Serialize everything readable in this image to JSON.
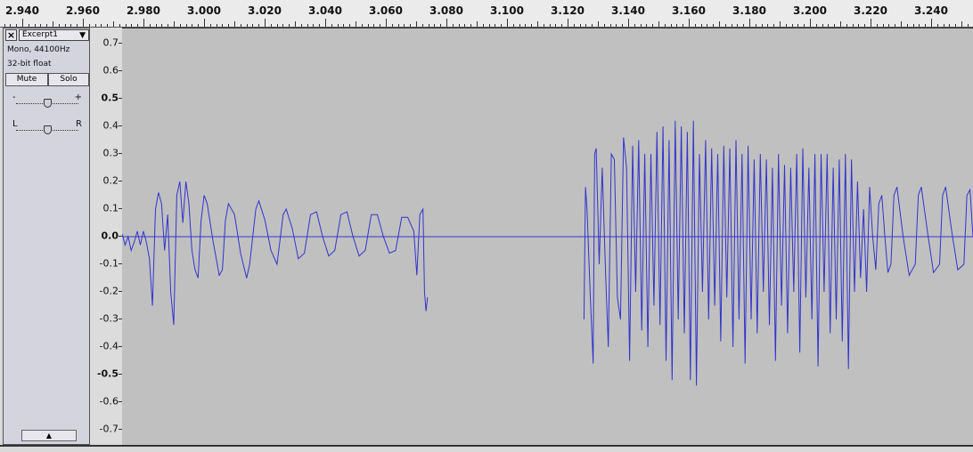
{
  "ruler": {
    "labels": [
      "2.940",
      "2.960",
      "2.980",
      "3.000",
      "3.020",
      "3.040",
      "3.060",
      "3.080",
      "3.100",
      "3.120",
      "3.140",
      "3.160",
      "3.180",
      "3.200",
      "3.220",
      "3.240"
    ]
  },
  "track": {
    "name": "Excerpt1",
    "close_label": "×",
    "dropdown_icon": "triangle-down-icon",
    "info_rate": "Mono, 44100Hz",
    "info_format": "32-bit float",
    "mute_label": "Mute",
    "solo_label": "Solo",
    "gain_minus": "-",
    "gain_plus": "+",
    "gain_level": 0.5,
    "pan_left": "L",
    "pan_right": "R",
    "pan_level": 0.5,
    "collapse_icon": "triangle-up-icon"
  },
  "amplitude_scale": {
    "labels": [
      "0.7",
      "0.6",
      "0.5",
      "0.4",
      "0.3",
      "0.2",
      "0.1",
      "0.0",
      "-0.1",
      "-0.2",
      "-0.3",
      "-0.4",
      "-0.5",
      "-0.6",
      "-0.7"
    ]
  },
  "waveform": {
    "color": "#3333cc",
    "background": "#c0c0c0",
    "time_start": 2.971,
    "time_end": 3.251,
    "amp_min": -0.75,
    "amp_max": 0.75,
    "segments": [
      {
        "points": [
          [
            2.971,
            0.01
          ],
          [
            2.972,
            -0.03
          ],
          [
            2.973,
            0.0
          ],
          [
            2.974,
            -0.05
          ],
          [
            2.975,
            -0.02
          ],
          [
            2.976,
            0.02
          ],
          [
            2.977,
            -0.03
          ],
          [
            2.978,
            0.02
          ],
          [
            2.979,
            -0.02
          ],
          [
            2.98,
            -0.08
          ],
          [
            2.981,
            -0.25
          ],
          [
            2.982,
            0.1
          ],
          [
            2.983,
            0.16
          ],
          [
            2.984,
            0.12
          ],
          [
            2.985,
            -0.05
          ],
          [
            2.986,
            0.08
          ],
          [
            2.987,
            -0.2
          ],
          [
            2.988,
            -0.32
          ],
          [
            2.989,
            0.15
          ],
          [
            2.99,
            0.2
          ],
          [
            2.991,
            0.05
          ],
          [
            2.992,
            0.2
          ],
          [
            2.993,
            0.12
          ],
          [
            2.994,
            -0.05
          ],
          [
            2.995,
            -0.12
          ],
          [
            2.996,
            -0.15
          ],
          [
            2.997,
            0.06
          ],
          [
            2.998,
            0.15
          ],
          [
            2.999,
            0.12
          ],
          [
            3.001,
            -0.02
          ],
          [
            3.003,
            -0.14
          ],
          [
            3.004,
            -0.12
          ],
          [
            3.005,
            0.06
          ],
          [
            3.006,
            0.12
          ],
          [
            3.008,
            0.08
          ],
          [
            3.01,
            -0.06
          ],
          [
            3.012,
            -0.15
          ],
          [
            3.013,
            -0.1
          ],
          [
            3.015,
            0.1
          ],
          [
            3.016,
            0.13
          ],
          [
            3.018,
            0.06
          ],
          [
            3.02,
            -0.05
          ],
          [
            3.022,
            -0.1
          ],
          [
            3.024,
            0.08
          ],
          [
            3.025,
            0.1
          ],
          [
            3.027,
            0.03
          ],
          [
            3.029,
            -0.08
          ],
          [
            3.031,
            -0.06
          ],
          [
            3.033,
            0.08
          ],
          [
            3.035,
            0.09
          ],
          [
            3.037,
            0.0
          ],
          [
            3.039,
            -0.07
          ],
          [
            3.041,
            -0.05
          ],
          [
            3.043,
            0.08
          ],
          [
            3.045,
            0.09
          ],
          [
            3.047,
            0.0
          ],
          [
            3.049,
            -0.07
          ],
          [
            3.051,
            -0.05
          ],
          [
            3.053,
            0.08
          ],
          [
            3.055,
            0.08
          ],
          [
            3.057,
            0.0
          ],
          [
            3.059,
            -0.06
          ],
          [
            3.061,
            -0.05
          ],
          [
            3.063,
            0.07
          ],
          [
            3.065,
            0.07
          ],
          [
            3.067,
            0.02
          ],
          [
            3.068,
            -0.14
          ],
          [
            3.069,
            0.08
          ],
          [
            3.07,
            0.1
          ],
          [
            3.0705,
            -0.2
          ],
          [
            3.071,
            -0.27
          ],
          [
            3.0715,
            -0.22
          ]
        ]
      },
      {
        "points": [
          [
            3.123,
            -0.3
          ],
          [
            3.1235,
            0.18
          ],
          [
            3.124,
            0.1
          ],
          [
            3.125,
            -0.2
          ],
          [
            3.126,
            -0.46
          ],
          [
            3.1265,
            0.3
          ],
          [
            3.127,
            0.32
          ],
          [
            3.128,
            -0.1
          ],
          [
            3.129,
            0.25
          ],
          [
            3.13,
            -0.1
          ],
          [
            3.131,
            -0.4
          ],
          [
            3.132,
            0.3
          ],
          [
            3.133,
            0.28
          ],
          [
            3.134,
            -0.22
          ],
          [
            3.135,
            -0.3
          ],
          [
            3.136,
            0.36
          ],
          [
            3.137,
            0.25
          ],
          [
            3.138,
            -0.45
          ],
          [
            3.139,
            0.33
          ],
          [
            3.14,
            -0.2
          ],
          [
            3.141,
            0.35
          ],
          [
            3.142,
            -0.34
          ],
          [
            3.143,
            0.3
          ],
          [
            3.144,
            -0.4
          ],
          [
            3.145,
            0.3
          ],
          [
            3.146,
            -0.25
          ],
          [
            3.147,
            0.38
          ],
          [
            3.148,
            -0.32
          ],
          [
            3.149,
            0.4
          ],
          [
            3.15,
            -0.45
          ],
          [
            3.151,
            0.35
          ],
          [
            3.152,
            -0.52
          ],
          [
            3.153,
            0.42
          ],
          [
            3.154,
            -0.3
          ],
          [
            3.155,
            0.4
          ],
          [
            3.156,
            -0.35
          ],
          [
            3.157,
            0.38
          ],
          [
            3.158,
            -0.52
          ],
          [
            3.159,
            0.42
          ],
          [
            3.16,
            -0.54
          ],
          [
            3.161,
            0.3
          ],
          [
            3.162,
            -0.2
          ],
          [
            3.163,
            0.35
          ],
          [
            3.164,
            -0.3
          ],
          [
            3.165,
            0.32
          ],
          [
            3.166,
            -0.25
          ],
          [
            3.167,
            0.3
          ],
          [
            3.168,
            -0.38
          ],
          [
            3.169,
            0.33
          ],
          [
            3.17,
            -0.22
          ],
          [
            3.171,
            0.32
          ],
          [
            3.172,
            -0.4
          ],
          [
            3.173,
            0.35
          ],
          [
            3.174,
            -0.3
          ],
          [
            3.175,
            0.3
          ],
          [
            3.176,
            -0.46
          ],
          [
            3.177,
            0.33
          ],
          [
            3.178,
            -0.3
          ],
          [
            3.179,
            0.28
          ],
          [
            3.18,
            -0.35
          ],
          [
            3.181,
            0.3
          ],
          [
            3.182,
            -0.2
          ],
          [
            3.183,
            0.28
          ],
          [
            3.184,
            -0.32
          ],
          [
            3.185,
            0.25
          ],
          [
            3.186,
            -0.45
          ],
          [
            3.187,
            0.3
          ],
          [
            3.188,
            -0.25
          ],
          [
            3.189,
            0.26
          ],
          [
            3.19,
            -0.35
          ],
          [
            3.191,
            0.25
          ],
          [
            3.192,
            -0.2
          ],
          [
            3.193,
            0.3
          ],
          [
            3.194,
            -0.42
          ],
          [
            3.195,
            0.32
          ],
          [
            3.196,
            -0.22
          ],
          [
            3.197,
            0.25
          ],
          [
            3.198,
            -0.3
          ],
          [
            3.199,
            0.3
          ],
          [
            3.2,
            -0.47
          ],
          [
            3.201,
            0.3
          ],
          [
            3.202,
            -0.2
          ],
          [
            3.203,
            0.3
          ],
          [
            3.204,
            -0.35
          ],
          [
            3.205,
            0.25
          ],
          [
            3.206,
            -0.3
          ],
          [
            3.207,
            0.28
          ],
          [
            3.208,
            -0.38
          ],
          [
            3.209,
            0.3
          ],
          [
            3.21,
            -0.48
          ],
          [
            3.211,
            0.28
          ],
          [
            3.212,
            -0.2
          ],
          [
            3.213,
            0.2
          ],
          [
            3.214,
            -0.15
          ],
          [
            3.215,
            0.1
          ],
          [
            3.216,
            -0.2
          ],
          [
            3.217,
            0.18
          ],
          [
            3.218,
            0.0
          ],
          [
            3.219,
            -0.12
          ],
          [
            3.22,
            0.12
          ],
          [
            3.221,
            0.15
          ],
          [
            3.222,
            0.0
          ],
          [
            3.223,
            -0.13
          ],
          [
            3.224,
            -0.1
          ],
          [
            3.225,
            0.15
          ],
          [
            3.226,
            0.18
          ],
          [
            3.228,
            0.0
          ],
          [
            3.23,
            -0.14
          ],
          [
            3.232,
            -0.1
          ],
          [
            3.233,
            0.15
          ],
          [
            3.234,
            0.18
          ],
          [
            3.236,
            0.02
          ],
          [
            3.238,
            -0.13
          ],
          [
            3.24,
            -0.1
          ],
          [
            3.241,
            0.15
          ],
          [
            3.242,
            0.18
          ],
          [
            3.244,
            0.02
          ],
          [
            3.246,
            -0.12
          ],
          [
            3.248,
            -0.1
          ],
          [
            3.249,
            0.15
          ],
          [
            3.25,
            0.17
          ],
          [
            3.251,
            0.0
          ]
        ]
      }
    ]
  }
}
